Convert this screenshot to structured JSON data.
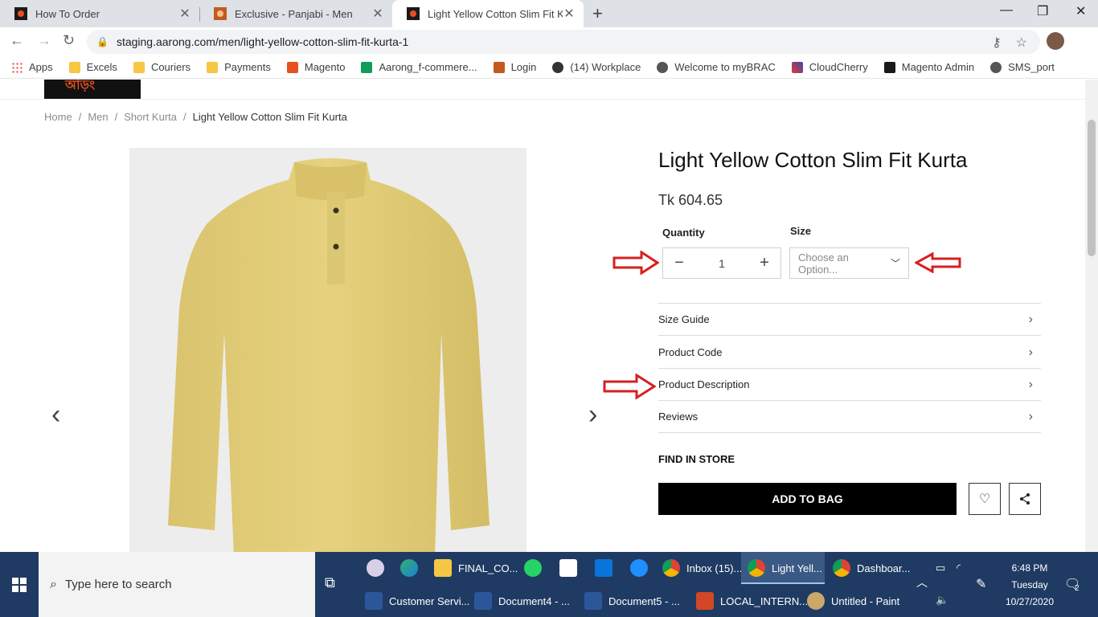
{
  "browser": {
    "tabs": [
      {
        "title": "How To Order",
        "active": false
      },
      {
        "title": "Exclusive - Panjabi - Men",
        "active": false
      },
      {
        "title": "Light Yellow Cotton Slim Fit Kurta",
        "active": true
      }
    ],
    "url": "staging.aarong.com/men/light-yellow-cotton-slim-fit-kurta-1",
    "bookmarks": [
      "Apps",
      "Excels",
      "Couriers",
      "Payments",
      "Magento",
      "Aarong_f-commere...",
      "Login",
      "(14) Workplace",
      "Welcome to myBRAC",
      "CloudCherry",
      "Magento Admin",
      "SMS_port"
    ]
  },
  "site": {
    "breadcrumb": [
      "Home",
      "Men",
      "Short Kurta",
      "Light Yellow Cotton Slim Fit Kurta"
    ]
  },
  "product": {
    "title": "Light Yellow Cotton Slim Fit Kurta",
    "price": "Tk 604.65",
    "quantity_label": "Quantity",
    "quantity_value": "1",
    "size_label": "Size",
    "size_placeholder": "Choose an Option...",
    "accordion": [
      "Size Guide",
      "Product Code",
      "Product Description",
      "Reviews"
    ],
    "find_in_store": "FIND IN STORE",
    "add_to_bag": "ADD TO BAG"
  },
  "taskbar": {
    "search_placeholder": "Type here to search",
    "row1": [
      "FINAL_CO...",
      "Inbox (15)...",
      "Light Yell...",
      "Dashboar..."
    ],
    "row2": [
      "Customer Servi...",
      "Document4 - ...",
      "Document5 - ...",
      "LOCAL_INTERN...",
      "Untitled - Paint"
    ],
    "time": "6:48 PM",
    "day": "Tuesday",
    "date": "10/27/2020",
    "notification_count": "2"
  }
}
